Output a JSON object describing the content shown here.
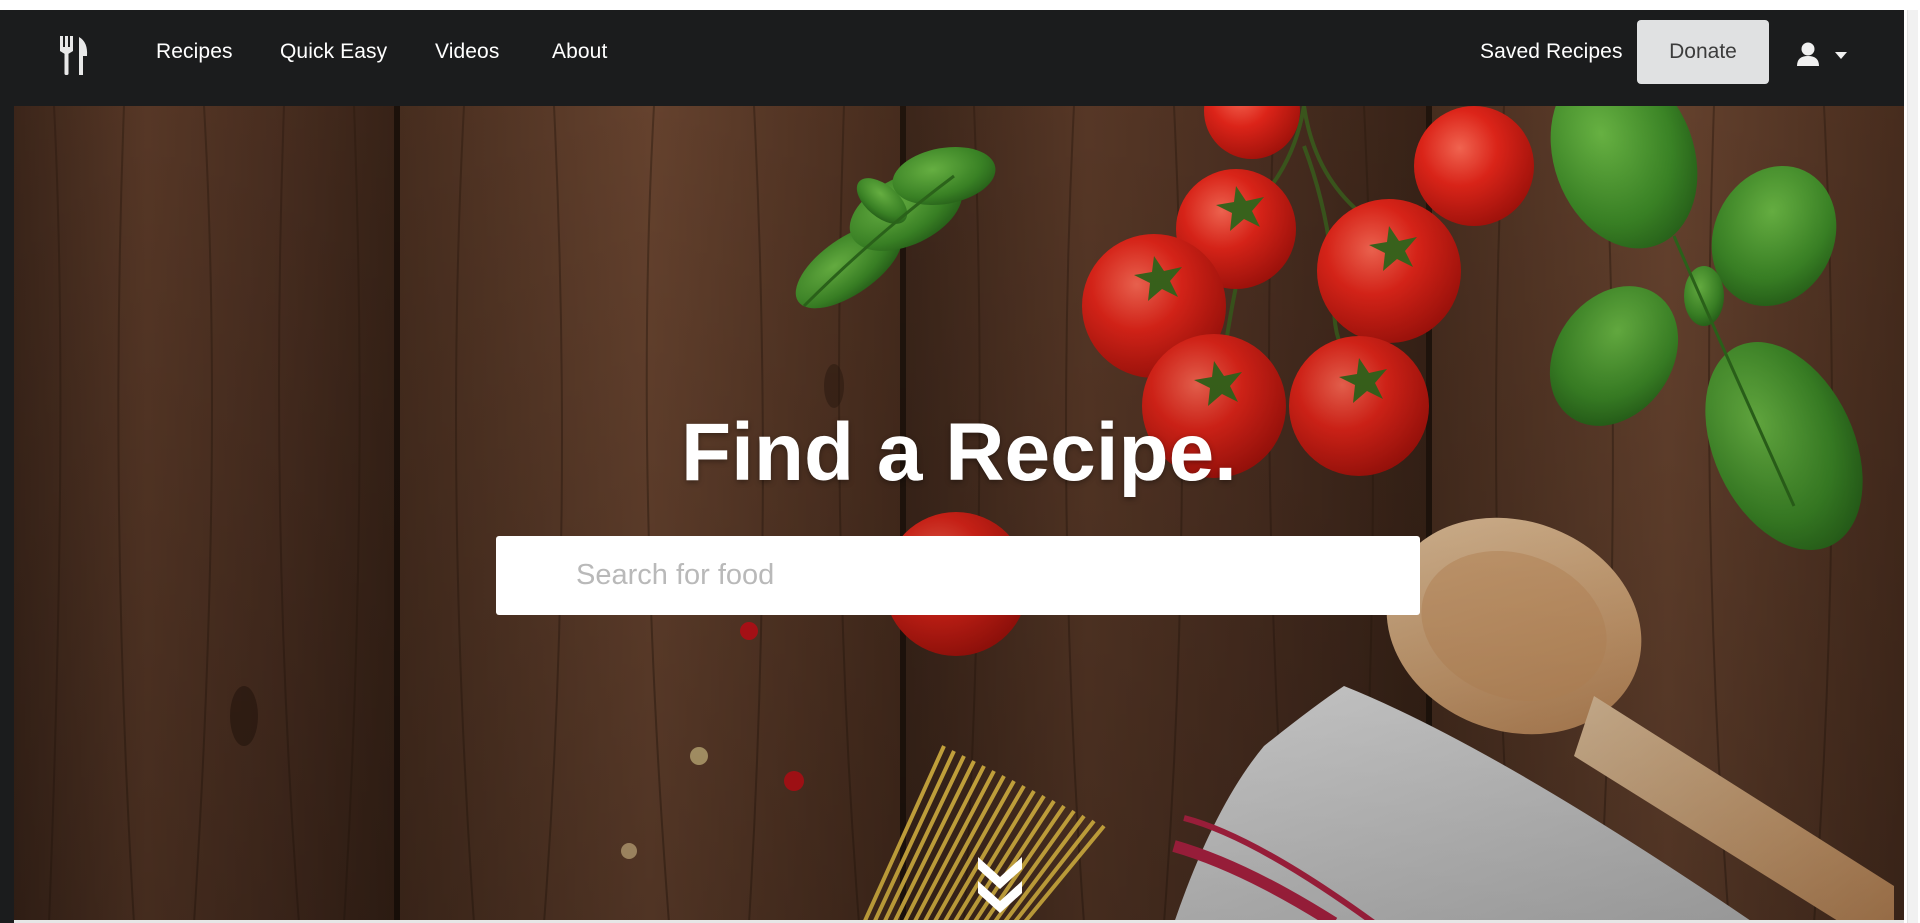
{
  "nav": {
    "links": [
      "Recipes",
      "Quick Easy",
      "Videos",
      "About"
    ],
    "saved_label": "Saved Recipes",
    "donate_label": "Donate"
  },
  "icons": {
    "logo": "fork-knife-icon",
    "user": "user-icon",
    "caret": "caret-down-icon",
    "scroll": "double-chevron-down-icon"
  },
  "hero": {
    "title": "Find a Recipe.",
    "search_placeholder": "Search for food",
    "search_value": ""
  },
  "colors": {
    "nav_bg": "#1b1c1d",
    "donate_bg": "#e0e1e2",
    "wood": "#4a3022",
    "tomato": "#e3241a",
    "basil": "#3f8a2a"
  }
}
